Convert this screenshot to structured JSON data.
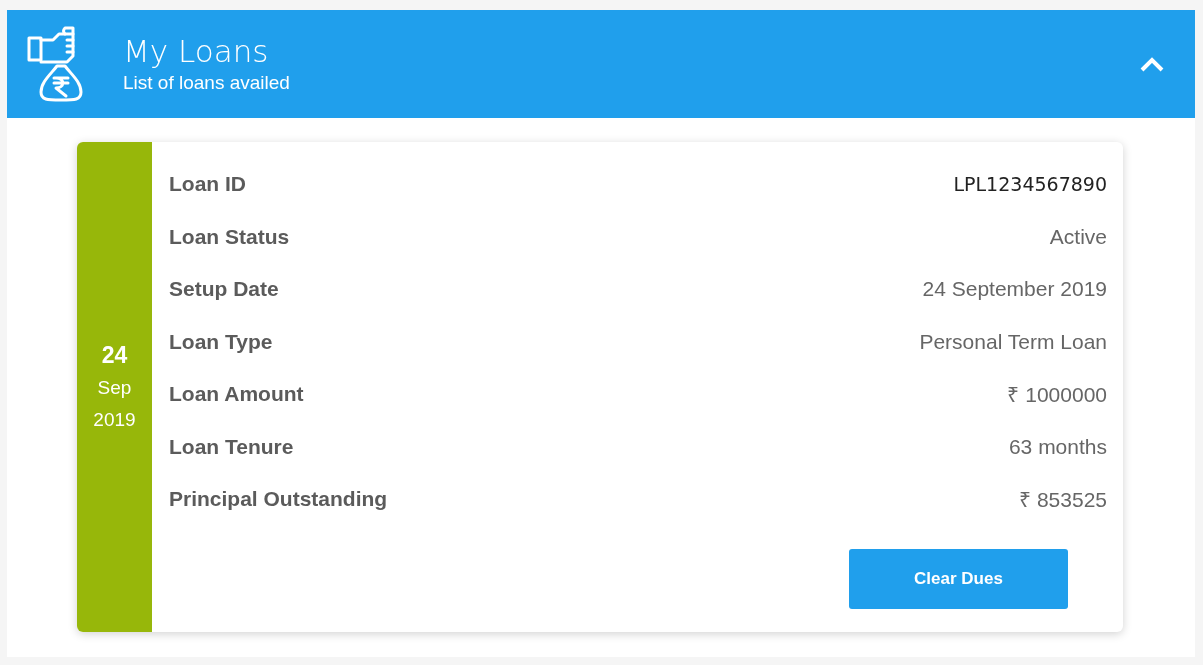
{
  "header": {
    "title": "My Loans",
    "subtitle": "List of loans availed",
    "expanded": true
  },
  "loan": {
    "date": {
      "day": "24",
      "month": "Sep",
      "year": "2019"
    },
    "details": [
      {
        "label": "Loan ID",
        "value": "LPL1234567890",
        "kind": "id"
      },
      {
        "label": "Loan Status",
        "value": "Active",
        "kind": "text"
      },
      {
        "label": "Setup Date",
        "value": "24 September 2019",
        "kind": "text"
      },
      {
        "label": "Loan Type",
        "value": "Personal Term Loan",
        "kind": "text"
      },
      {
        "label": "Loan Amount",
        "value": "₹ 1000000",
        "kind": "text"
      },
      {
        "label": "Loan Tenure",
        "value": "63 months",
        "kind": "text"
      },
      {
        "label": "Principal Outstanding",
        "value": "₹ 853525",
        "kind": "text"
      }
    ],
    "button": "Clear Dues"
  }
}
